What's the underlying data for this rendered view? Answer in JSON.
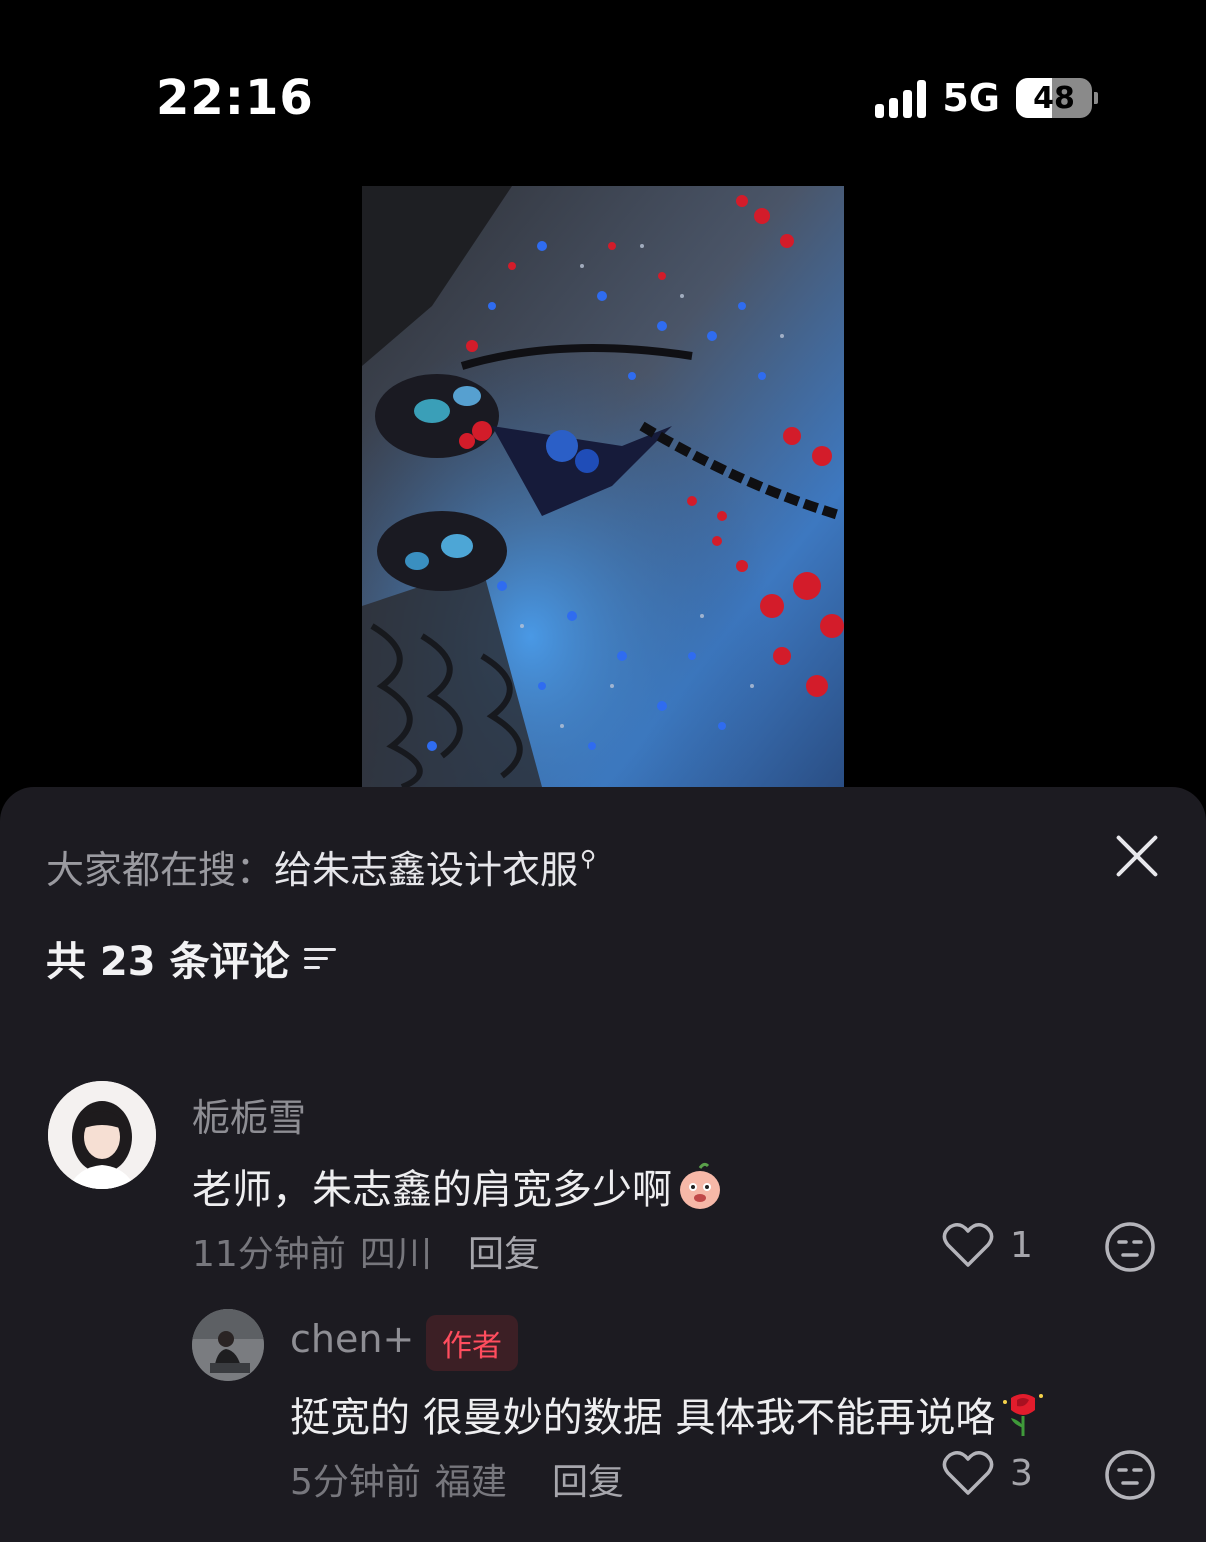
{
  "status_bar": {
    "time": "22:16",
    "network": "5G",
    "battery": "48",
    "battery_level": 0.48
  },
  "media": {
    "icon": "beaded-corset-photo"
  },
  "sheet": {
    "search_prefix": "大家都在搜：",
    "search_query": "给朱志鑫设计衣服",
    "comment_count": "共 23 条评论"
  },
  "comments": [
    {
      "username": "栀栀雪",
      "text": "老师，朱志鑫的肩宽多少啊",
      "time": "11分钟前",
      "location": "四川",
      "reply_label": "回复",
      "likes": "1"
    }
  ],
  "replies": [
    {
      "username": "chen+",
      "badge": "作者",
      "text": "挺宽的 很曼妙的数据 具体我不能再说咯",
      "time": "5分钟前",
      "location": "福建",
      "reply_label": "回复",
      "likes": "3"
    }
  ]
}
